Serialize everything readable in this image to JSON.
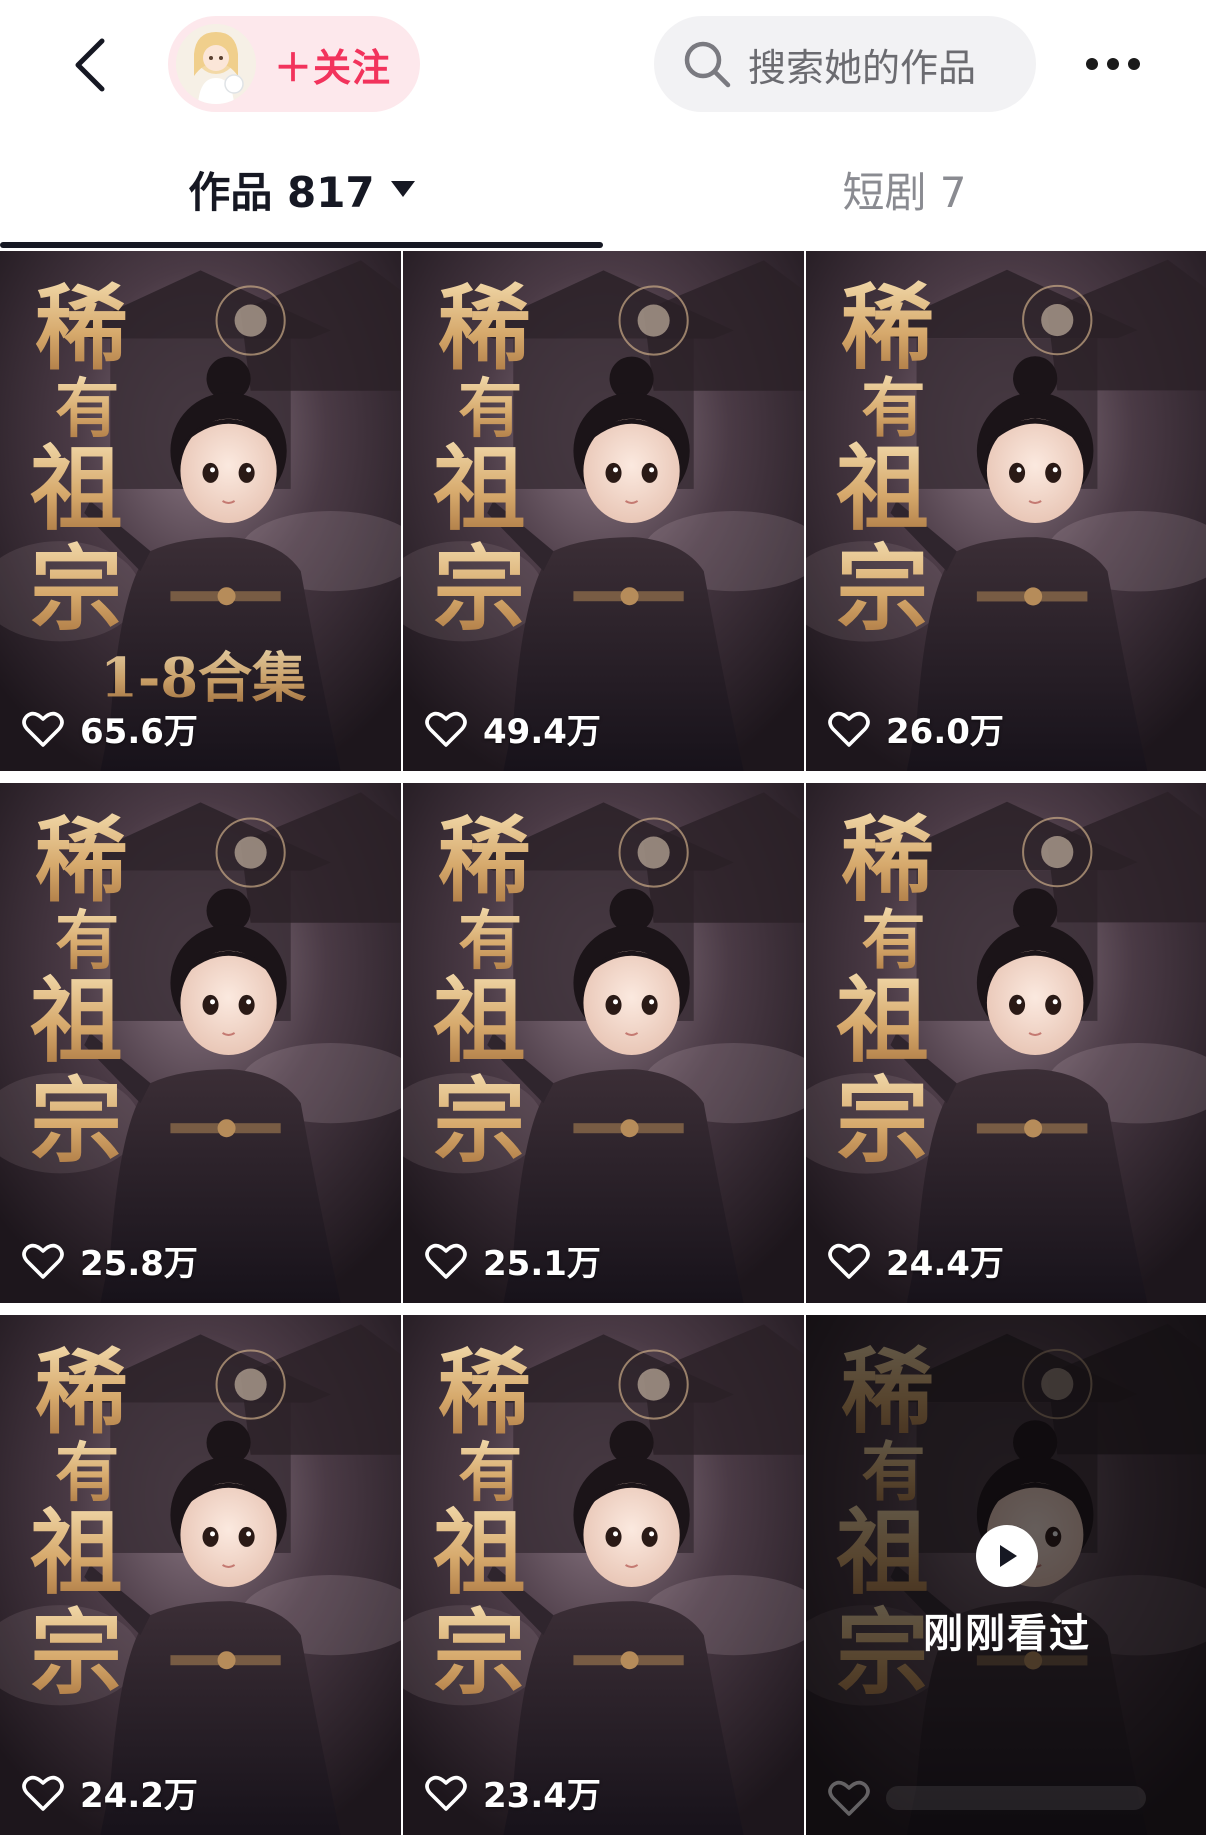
{
  "header": {
    "follow_label": "＋关注",
    "search_placeholder": "搜索她的作品"
  },
  "tabs": [
    {
      "label": "作品 817",
      "active": true
    },
    {
      "label": "短剧 7",
      "active": false
    }
  ],
  "cover": {
    "title_chars": [
      "稀",
      "有",
      "祖",
      "宗"
    ],
    "badge": "1-8合集"
  },
  "videos": [
    {
      "likes": "65.6万",
      "badge": true
    },
    {
      "likes": "49.4万"
    },
    {
      "likes": "26.0万"
    },
    {
      "likes": "25.8万"
    },
    {
      "likes": "25.1万"
    },
    {
      "likes": "24.4万"
    },
    {
      "likes": "24.2万"
    },
    {
      "likes": "23.4万"
    },
    {
      "likes": "",
      "watched": true
    }
  ],
  "watched_label": "刚刚看过",
  "colors": {
    "accent": "#f2335c",
    "pill_bg": "#fde8ec",
    "cover_gold": "#d9b27a",
    "cover_dark": "#2a2129"
  },
  "icons": {
    "back": "chevron-left-icon",
    "search": "search-icon",
    "more": "ellipsis-icon",
    "like": "heart-outline-icon",
    "play": "play-icon"
  }
}
